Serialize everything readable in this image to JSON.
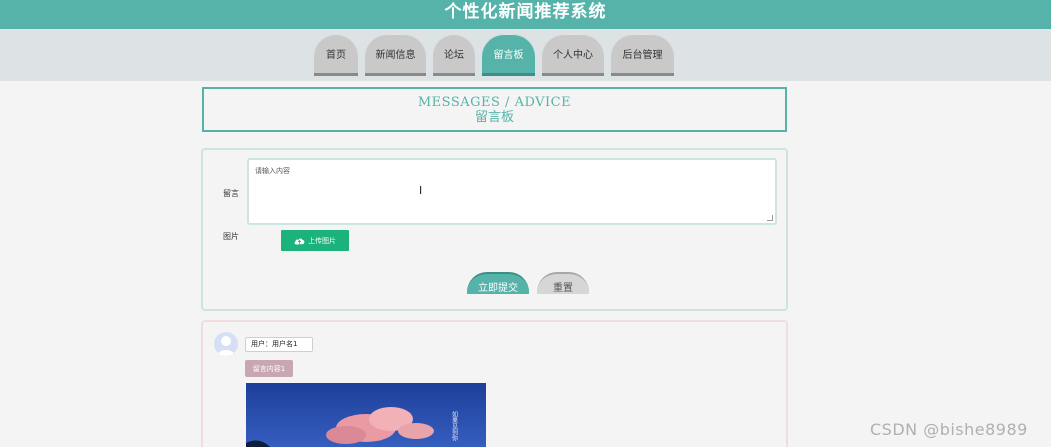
{
  "header": {
    "site_title": "个性化新闻推荐系统"
  },
  "nav": {
    "items": [
      {
        "label": "首页",
        "active": false
      },
      {
        "label": "新闻信息",
        "active": false
      },
      {
        "label": "论坛",
        "active": false
      },
      {
        "label": "留言板",
        "active": true
      },
      {
        "label": "个人中心",
        "active": false
      },
      {
        "label": "后台管理",
        "active": false
      }
    ]
  },
  "title_box": {
    "english": "MESSAGES / ADVICE",
    "chinese": "留言板"
  },
  "form": {
    "message_label": "留言",
    "message_placeholder": "请输入内容",
    "image_label": "图片",
    "upload_label": "上传图片",
    "submit_label": "立即提交",
    "reset_label": "重置"
  },
  "message": {
    "user_tag": "用户：用户名1",
    "content_tag": "留言内容1",
    "image_caption": "如果见到你"
  },
  "watermark": "CSDN @bishe8989",
  "colors": {
    "accent": "#56b3a9",
    "upload_green": "#1bb27b",
    "content_tag": "#c8a7b3"
  }
}
